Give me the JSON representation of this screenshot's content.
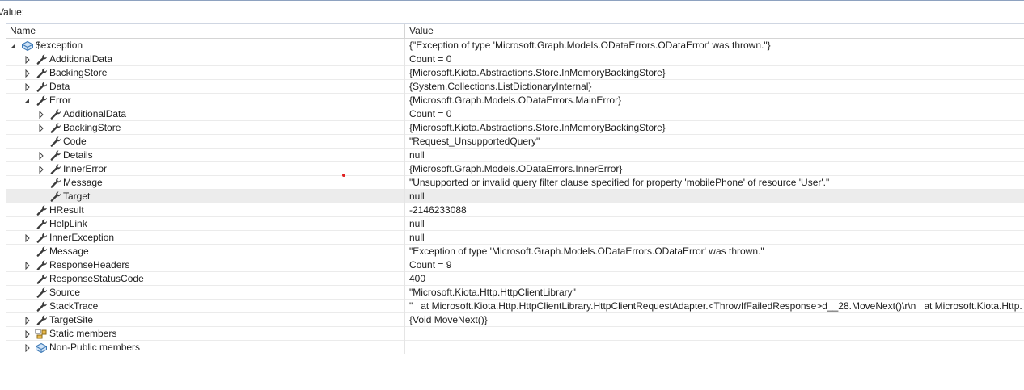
{
  "value_bar": {
    "label": "Value:"
  },
  "header": {
    "name": "Name",
    "value": "Value"
  },
  "rows": [
    {
      "name": "$exception",
      "value": "{\"Exception of type 'Microsoft.Graph.Models.ODataErrors.ODataError' was thrown.\"}",
      "depth": 0,
      "expander": "expanded",
      "icon": "exception-icon"
    },
    {
      "name": "AdditionalData",
      "value": "Count = 0",
      "depth": 1,
      "expander": "collapsed",
      "icon": "wrench-icon"
    },
    {
      "name": "BackingStore",
      "value": "{Microsoft.Kiota.Abstractions.Store.InMemoryBackingStore}",
      "depth": 1,
      "expander": "collapsed",
      "icon": "wrench-icon"
    },
    {
      "name": "Data",
      "value": "{System.Collections.ListDictionaryInternal}",
      "depth": 1,
      "expander": "collapsed",
      "icon": "wrench-icon"
    },
    {
      "name": "Error",
      "value": "{Microsoft.Graph.Models.ODataErrors.MainError}",
      "depth": 1,
      "expander": "expanded",
      "icon": "wrench-icon"
    },
    {
      "name": "AdditionalData",
      "value": "Count = 0",
      "depth": 2,
      "expander": "collapsed",
      "icon": "wrench-icon"
    },
    {
      "name": "BackingStore",
      "value": "{Microsoft.Kiota.Abstractions.Store.InMemoryBackingStore}",
      "depth": 2,
      "expander": "collapsed",
      "icon": "wrench-icon"
    },
    {
      "name": "Code",
      "value": "\"Request_UnsupportedQuery\"",
      "depth": 2,
      "expander": "none",
      "icon": "wrench-icon"
    },
    {
      "name": "Details",
      "value": "null",
      "depth": 2,
      "expander": "collapsed",
      "icon": "wrench-icon"
    },
    {
      "name": "InnerError",
      "value": "{Microsoft.Graph.Models.ODataErrors.InnerError}",
      "depth": 2,
      "expander": "collapsed",
      "icon": "wrench-icon"
    },
    {
      "name": "Message",
      "value": "\"Unsupported or invalid query filter clause specified for property 'mobilePhone' of resource 'User'.\"",
      "depth": 2,
      "expander": "none",
      "icon": "wrench-icon"
    },
    {
      "name": "Target",
      "value": "null",
      "depth": 2,
      "expander": "none",
      "icon": "wrench-icon",
      "selected": true
    },
    {
      "name": "HResult",
      "value": "-2146233088",
      "depth": 1,
      "expander": "none",
      "icon": "wrench-icon"
    },
    {
      "name": "HelpLink",
      "value": "null",
      "depth": 1,
      "expander": "none",
      "icon": "wrench-icon"
    },
    {
      "name": "InnerException",
      "value": "null",
      "depth": 1,
      "expander": "collapsed",
      "icon": "wrench-icon"
    },
    {
      "name": "Message",
      "value": "\"Exception of type 'Microsoft.Graph.Models.ODataErrors.ODataError' was thrown.\"",
      "depth": 1,
      "expander": "none",
      "icon": "wrench-icon"
    },
    {
      "name": "ResponseHeaders",
      "value": "Count = 9",
      "depth": 1,
      "expander": "collapsed",
      "icon": "wrench-icon"
    },
    {
      "name": "ResponseStatusCode",
      "value": "400",
      "depth": 1,
      "expander": "none",
      "icon": "wrench-icon"
    },
    {
      "name": "Source",
      "value": "\"Microsoft.Kiota.Http.HttpClientLibrary\"",
      "depth": 1,
      "expander": "none",
      "icon": "wrench-icon"
    },
    {
      "name": "StackTrace",
      "value": "\"   at Microsoft.Kiota.Http.HttpClientLibrary.HttpClientRequestAdapter.<ThrowIfFailedResponse>d__28.MoveNext()\\r\\n   at Microsoft.Kiota.Http.",
      "depth": 1,
      "expander": "none",
      "icon": "wrench-icon"
    },
    {
      "name": "TargetSite",
      "value": "{Void MoveNext()}",
      "depth": 1,
      "expander": "collapsed",
      "icon": "wrench-icon"
    },
    {
      "name": "Static members",
      "value": "",
      "depth": 1,
      "expander": "collapsed",
      "icon": "static-members-icon"
    },
    {
      "name": "Non-Public members",
      "value": "",
      "depth": 1,
      "expander": "collapsed",
      "icon": "object-icon"
    }
  ]
}
